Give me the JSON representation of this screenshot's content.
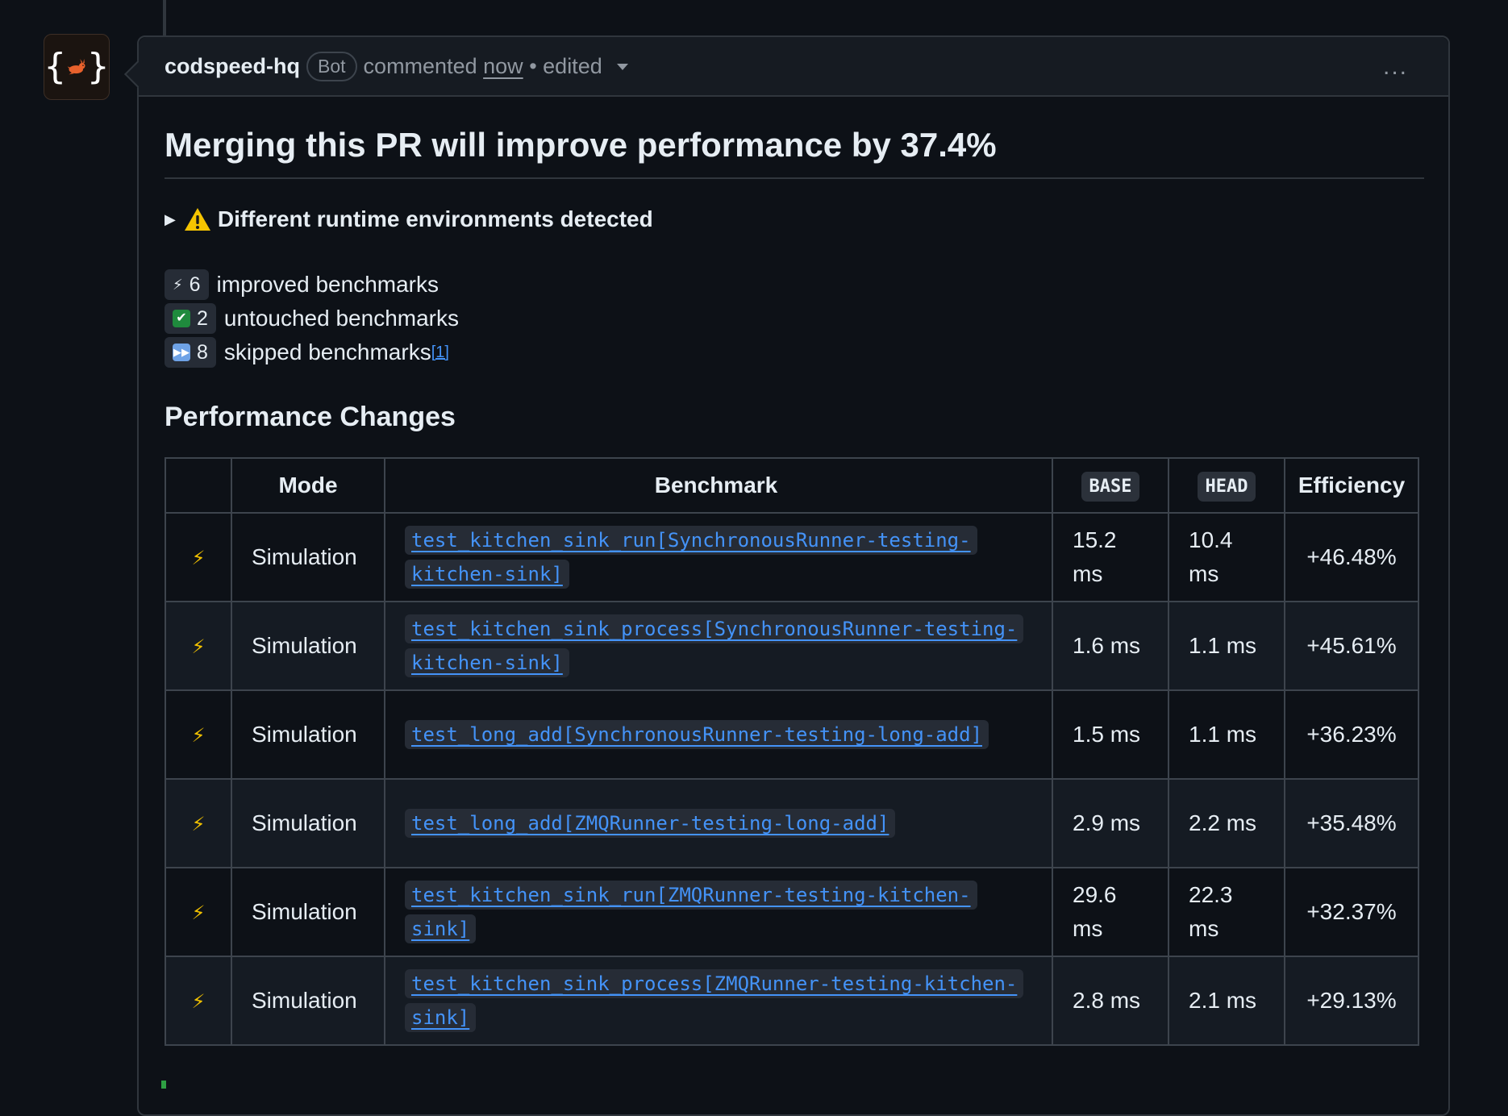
{
  "comment": {
    "author": "codspeed-hq",
    "badge": "Bot",
    "action": "commented",
    "time": "now",
    "separator": "•",
    "edited": "edited",
    "more": "..."
  },
  "content": {
    "title": "Merging this PR will improve performance by 37.4%",
    "details_summary": "Different runtime environments detected",
    "summary": [
      {
        "icon": "⚡",
        "count": "6",
        "label": "improved benchmarks"
      },
      {
        "icon": "✅",
        "count": "2",
        "label": "untouched benchmarks"
      },
      {
        "icon": "⏩",
        "count": "8",
        "label": "skipped benchmarks",
        "footnote": "[1]"
      }
    ],
    "section_title": "Performance Changes"
  },
  "table": {
    "headers": [
      "",
      "Mode",
      "Benchmark",
      "BASE",
      "HEAD",
      "Efficiency"
    ],
    "rows": [
      {
        "icon": "⚡",
        "mode": "Simulation",
        "benchmark": "test_kitchen_sink_run[SynchronousRunner-testing-kitchen-sink]",
        "base": "15.2 ms",
        "head": "10.4 ms",
        "efficiency": "+46.48%"
      },
      {
        "icon": "⚡",
        "mode": "Simulation",
        "benchmark": "test_kitchen_sink_process[SynchronousRunner-testing-kitchen-sink]",
        "base": "1.6 ms",
        "head": "1.1 ms",
        "efficiency": "+45.61%"
      },
      {
        "icon": "⚡",
        "mode": "Simulation",
        "benchmark": "test_long_add[SynchronousRunner-testing-long-add]",
        "base": "1.5 ms",
        "head": "1.1 ms",
        "efficiency": "+36.23%"
      },
      {
        "icon": "⚡",
        "mode": "Simulation",
        "benchmark": "test_long_add[ZMQRunner-testing-long-add]",
        "base": "2.9 ms",
        "head": "2.2 ms",
        "efficiency": "+35.48%"
      },
      {
        "icon": "⚡",
        "mode": "Simulation",
        "benchmark": "test_kitchen_sink_run[ZMQRunner-testing-kitchen-sink]",
        "base": "29.6 ms",
        "head": "22.3 ms",
        "efficiency": "+32.37%"
      },
      {
        "icon": "⚡",
        "mode": "Simulation",
        "benchmark": "test_kitchen_sink_process[ZMQRunner-testing-kitchen-sink]",
        "base": "2.8 ms",
        "head": "2.1 ms",
        "efficiency": "+29.13%"
      }
    ]
  },
  "colors": {
    "background": "#0d1117",
    "header_bg": "#161b22",
    "border": "#30363d",
    "link": "#4493f8",
    "text": "#e6edf3",
    "muted": "#9198a1",
    "bolt": "#f0c000",
    "avatar_rabbit": "#e8612c"
  }
}
